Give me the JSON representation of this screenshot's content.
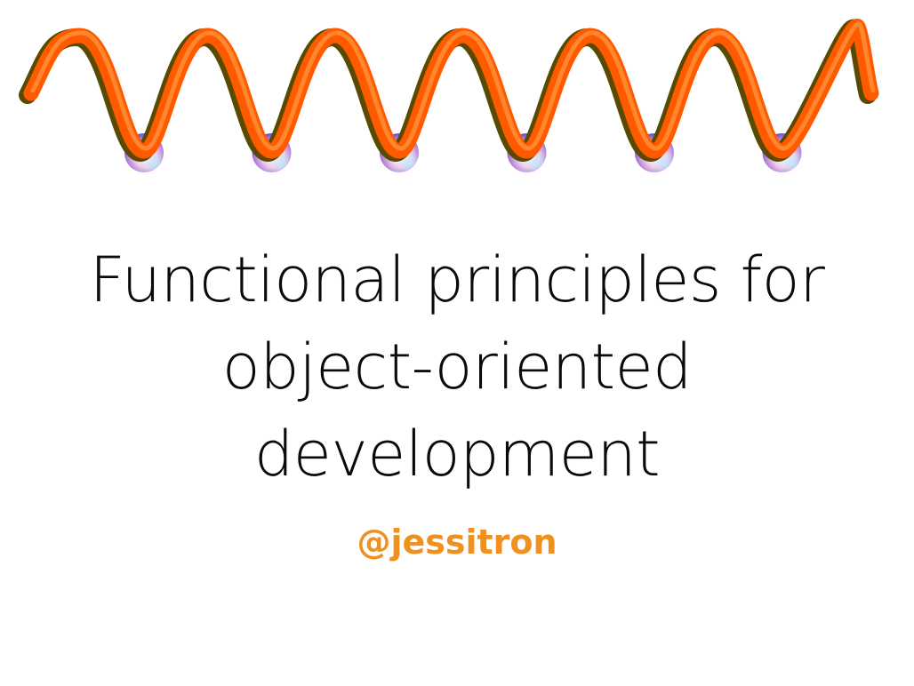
{
  "slide": {
    "title_lines": [
      "Functional principles for",
      "object-oriented",
      "development"
    ],
    "author_handle": "@jessitron",
    "colors": {
      "background": "#ffffff",
      "title_text": "#0a0a0a",
      "author_text": "#f0901e",
      "spiral_tube": "#ff5a00",
      "spiral_shadow": "#5a4a00",
      "sphere_highlight": "#ffffff",
      "sphere_mid": "#d9a0c8",
      "sphere_edge": "#7a4fd0"
    },
    "illustration": {
      "name": "helix-spring-illustration",
      "loops": 6,
      "spheres": 6
    }
  }
}
